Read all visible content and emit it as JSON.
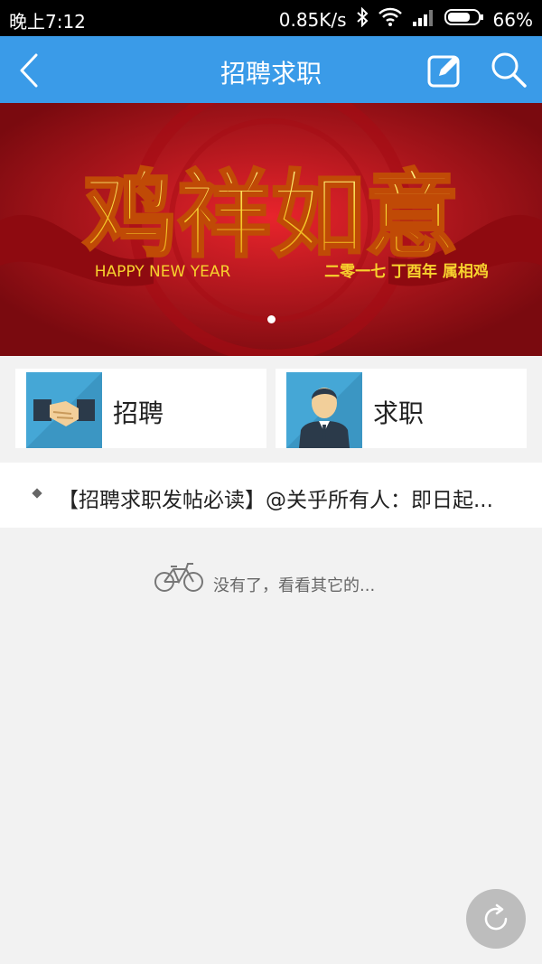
{
  "status_bar": {
    "time": "晚上7:12",
    "network_speed": "0.85K/s",
    "battery": "66%",
    "icons": [
      "bluetooth-icon",
      "wifi-icon",
      "signal-icon",
      "battery-icon"
    ]
  },
  "appbar": {
    "title": "招聘求职",
    "back_icon": "chevron-left-icon",
    "edit_icon": "edit-icon",
    "search_icon": "search-icon",
    "color": "#3a9be8"
  },
  "banner": {
    "headline": "鸡祥如意",
    "subtitle_en": "HAPPY NEW YEAR",
    "subtitle_cn": "二零一七 丁酉年 属相鸡",
    "page_indicator_count": 1,
    "colors": {
      "background": "#b80f17",
      "title": "#f7d22e"
    }
  },
  "categories": [
    {
      "label": "招聘",
      "icon": "handshake-icon"
    },
    {
      "label": "求职",
      "icon": "job-seeker-icon"
    }
  ],
  "notices": [
    {
      "text": "【招聘求职发帖必读】@关乎所有人：即日起..."
    }
  ],
  "empty_state": {
    "icon": "bicycle-icon",
    "text": "没有了，看看其它的..."
  },
  "refresh_button": {
    "icon": "refresh-icon"
  }
}
